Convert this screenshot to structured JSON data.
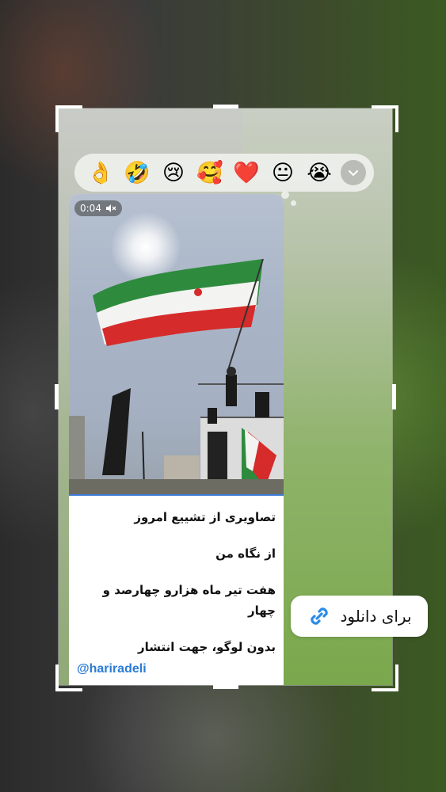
{
  "reactions": [
    {
      "emoji": "👌",
      "icon": "ok-hand-icon"
    },
    {
      "emoji": "🤣",
      "icon": "rofl-icon"
    },
    {
      "emoji": "😢",
      "icon": "crying-face-icon"
    },
    {
      "emoji": "🥰",
      "icon": "smiling-hearts-icon"
    },
    {
      "emoji": "❤️",
      "icon": "red-heart-icon"
    },
    {
      "emoji": "😐",
      "icon": "neutral-face-icon"
    },
    {
      "emoji": "😭",
      "icon": "loudly-crying-icon"
    }
  ],
  "video": {
    "duration": "0:04",
    "muted_icon": "speaker-muted-icon"
  },
  "caption": {
    "line1": "تصاویری از تشییع امروز",
    "line2": "از نگاه من",
    "line3": "هفت تیر ماه هزارو چهارصد و چهار",
    "line4": "بدون لوگو، جهت انتشار",
    "handle": "@hariradeli"
  },
  "download": {
    "label": "برای دانلود",
    "icon": "link-icon"
  },
  "colors": {
    "accent_link": "#2a7bd6",
    "progress": "#3d7bd9",
    "flag_green": "#2e8b3e",
    "flag_red": "#d62b2b"
  }
}
